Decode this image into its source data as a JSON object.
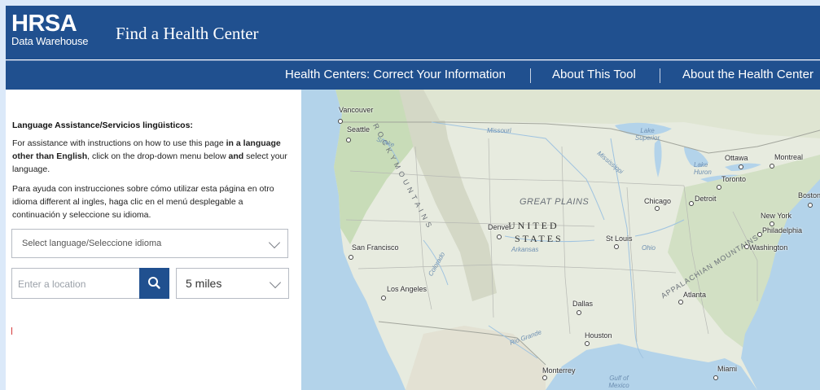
{
  "header": {
    "logo_word": "HRSA",
    "logo_sub": "Data Warehouse",
    "title": "Find a Health Center"
  },
  "nav": {
    "items": [
      {
        "label": "Health Centers: Correct Your Information"
      },
      {
        "label": "About This Tool"
      },
      {
        "label": "About the Health Center"
      }
    ]
  },
  "panel": {
    "heading": "Language Assistance/Servicios lingüisticos:",
    "para1_part1": "For assistance with instructions on how to use this page ",
    "para1_bold1": "in a language other than English",
    "para1_part2": ", click on the drop-down menu below ",
    "para1_bold2": "and",
    "para1_part3": " select your language.",
    "para2": "Para ayuda con instrucciones sobre cómo utilizar esta página en otro idioma different al ingles, haga clic en el menú desplegable a continuación y seleccione su idioma.",
    "language_select_label": "Select language/Seleccione idioma",
    "location_placeholder": "Enter a location",
    "radius_value": "5 miles"
  },
  "map": {
    "cities": [
      "Vancouver",
      "Seattle",
      "Ottawa",
      "Montreal",
      "Toronto",
      "Boston",
      "Detroit",
      "Chicago",
      "Denver",
      "New York",
      "Philadelphia",
      "St Louis",
      "Washington",
      "San Francisco",
      "Los Angeles",
      "Atlanta",
      "Dallas",
      "Houston",
      "Monterrey",
      "Miami"
    ],
    "country_line1": "UNITED",
    "country_line2": "STATES",
    "region_great_plains": "GREAT PLAINS",
    "mountains_rocky": "R O C K Y   M O U N T A I N S",
    "mountains_appalachian": "APPALACHIAN MOUNTAINS",
    "water": [
      "Missouri",
      "Lake Superior",
      "Lake Huron",
      "Mississippi",
      "Arkansas",
      "Ohio",
      "Snake",
      "Colorado",
      "Rio Grande",
      "Gulf of Mexico"
    ],
    "colors": {
      "land": "#e7ebdf",
      "water": "#b3d3ea",
      "green": "#c8dcb8",
      "mountain": "#d4d8c6"
    }
  },
  "colors": {
    "brand": "#20508f",
    "page_bg": "#dbe9f9"
  }
}
